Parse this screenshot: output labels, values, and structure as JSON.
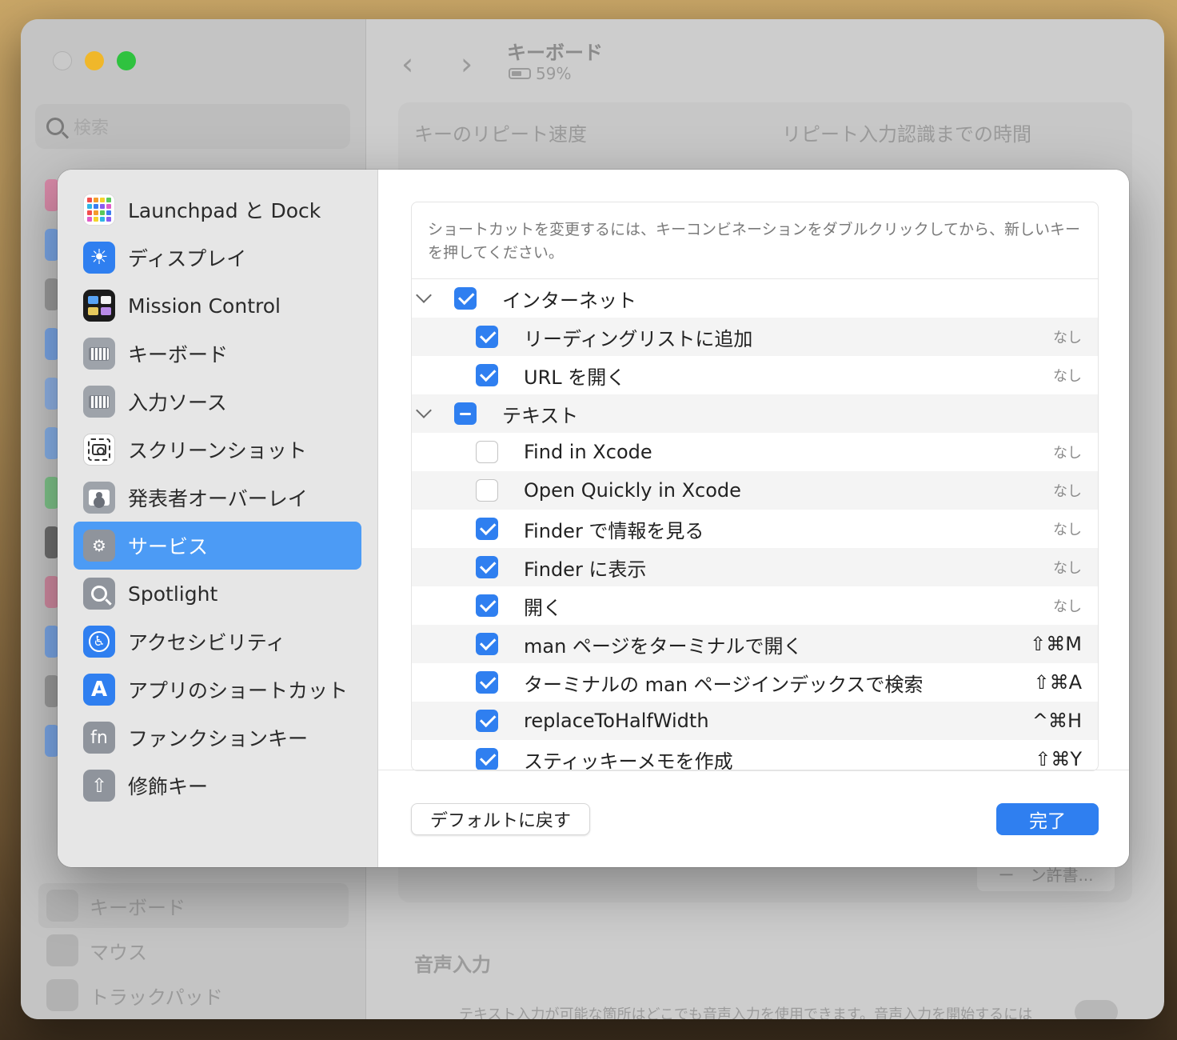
{
  "background": {
    "search_placeholder": "検索",
    "window_title": "キーボード",
    "battery": "59%",
    "repeat_speed_label": "キーのリピート速度",
    "repeat_delay_label": "リピート入力認識までの時間",
    "voice_input_label": "音声入力",
    "voice_input_desc": "テキスト入力が可能な箇所はどこでも音声入力を使用できます。音声入力を開始するには",
    "ghost_button": "ー　ン許書...",
    "bottom_items": [
      {
        "label": "キーボード",
        "icon": "keyboard-icon"
      },
      {
        "label": "マウス",
        "icon": "mouse-icon"
      },
      {
        "label": "トラックパッド",
        "icon": "trackpad-icon"
      }
    ]
  },
  "dialog": {
    "sidebar": [
      {
        "label": "Launchpad と Dock",
        "icon": "launchpad-icon",
        "selected": false
      },
      {
        "label": "ディスプレイ",
        "icon": "display-icon",
        "selected": false
      },
      {
        "label": "Mission Control",
        "icon": "mission-control-icon",
        "selected": false
      },
      {
        "label": "キーボード",
        "icon": "keyboard-icon",
        "selected": false
      },
      {
        "label": "入力ソース",
        "icon": "input-source-icon",
        "selected": false
      },
      {
        "label": "スクリーンショット",
        "icon": "screenshot-icon",
        "selected": false
      },
      {
        "label": "発表者オーバーレイ",
        "icon": "presenter-overlay-icon",
        "selected": false
      },
      {
        "label": "サービス",
        "icon": "services-gear-icon",
        "selected": true
      },
      {
        "label": "Spotlight",
        "icon": "spotlight-icon",
        "selected": false
      },
      {
        "label": "アクセシビリティ",
        "icon": "accessibility-icon",
        "selected": false
      },
      {
        "label": "アプリのショートカット",
        "icon": "app-shortcuts-icon",
        "selected": false
      },
      {
        "label": "ファンクションキー",
        "icon": "fn-key-icon",
        "selected": false
      },
      {
        "label": "修飾キー",
        "icon": "modifier-key-icon",
        "selected": false
      }
    ],
    "instructions": "ショートカットを変更するには、キーコンビネーションをダブルクリックしてから、新しいキーを押してください。",
    "groups": [
      {
        "label": "インターネット",
        "state": "checked",
        "items": [
          {
            "label": "リーディングリストに追加",
            "checked": true,
            "shortcut": "なし"
          },
          {
            "label": "URL を開く",
            "checked": true,
            "shortcut": "なし"
          }
        ]
      },
      {
        "label": "テキスト",
        "state": "mixed",
        "items": [
          {
            "label": "Find in Xcode",
            "checked": false,
            "shortcut": "なし"
          },
          {
            "label": "Open Quickly in Xcode",
            "checked": false,
            "shortcut": "なし"
          },
          {
            "label": "Finder で情報を見る",
            "checked": true,
            "shortcut": "なし"
          },
          {
            "label": "Finder に表示",
            "checked": true,
            "shortcut": "なし"
          },
          {
            "label": "開く",
            "checked": true,
            "shortcut": "なし"
          },
          {
            "label": "man ページをターミナルで開く",
            "checked": true,
            "shortcut": "⇧⌘M"
          },
          {
            "label": "ターミナルの man ページインデックスで検索",
            "checked": true,
            "shortcut": "⇧⌘A"
          },
          {
            "label": "replaceToHalfWidth",
            "checked": true,
            "shortcut": "^⌘H"
          },
          {
            "label": "スティッキーメモを作成",
            "checked": true,
            "shortcut": "⇧⌘Y"
          }
        ]
      }
    ],
    "restore_default_label": "デフォルトに戻す",
    "done_label": "完了"
  }
}
